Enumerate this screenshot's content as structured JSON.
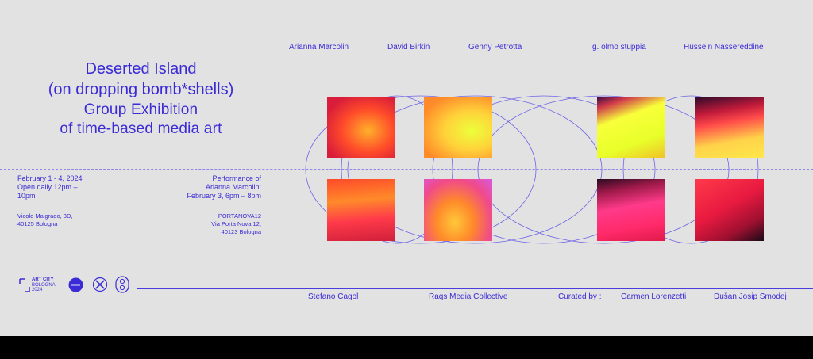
{
  "top_artists": [
    "Arianna Marcolin",
    "David Birkin",
    "Genny Petrotta",
    "g. olmo stuppia",
    "Hussein Nassereddine"
  ],
  "title": {
    "line1": "Deserted Island",
    "line2": "(on dropping bomb*shells)",
    "line3": "Group Exhibition",
    "line4": "of time-based media art"
  },
  "dates": {
    "line1": "February 1 - 4, 2024",
    "line2": "Open daily 12pm –",
    "line3": "10pm"
  },
  "venue1": {
    "line1": "Vicolo Malgrado, 3D,",
    "line2": "40125 Bologna"
  },
  "performance": {
    "line1": "Performance of",
    "line2": "Arianna Marcolin:",
    "line3": "February 3, 6pm – 8pm"
  },
  "venue2": {
    "line1": "PORTANOVA12",
    "line2": "Via Porta Nova 12,",
    "line3": "40123 Bologna"
  },
  "bottom": {
    "artist1": "Stefano Cagol",
    "artist2": "Raqs Media Collective",
    "curated_label": "Curated by :",
    "curator1": "Carmen Lorenzetti",
    "curator2": "Dušan Josip Smodej"
  },
  "logos": {
    "art_city": [
      "ART CITY",
      "BOLOGNA",
      "2024"
    ],
    "logo2_icon": "circle-badge-icon",
    "logo3_icon": "crossed-circle-icon",
    "logo4_icon": "double-circle-icon"
  },
  "colors": {
    "background": "#e2e2e2",
    "ink": "#3a2bd6",
    "accent": "#4a3de0"
  }
}
